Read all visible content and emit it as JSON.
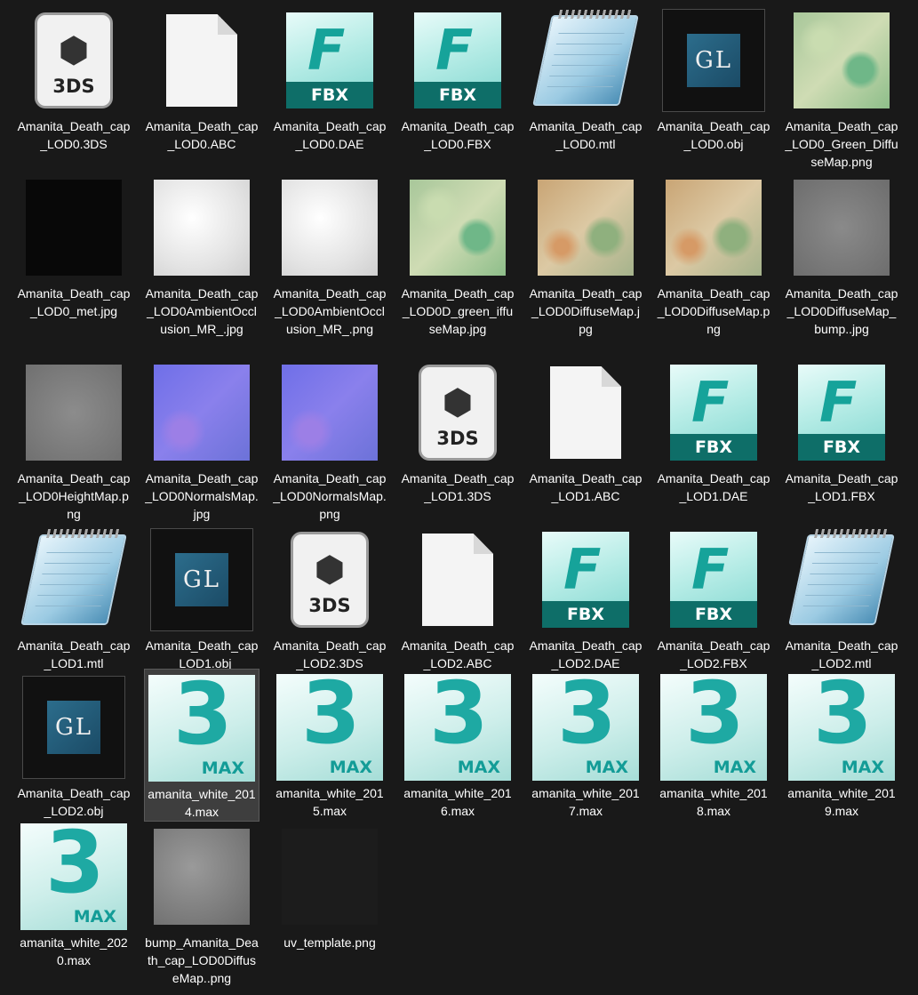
{
  "files": [
    {
      "name": "Amanita_Death_cap_LOD0.3DS",
      "icon": "3ds-icon"
    },
    {
      "name": "Amanita_Death_cap_LOD0.ABC",
      "icon": "blank-file-icon"
    },
    {
      "name": "Amanita_Death_cap_LOD0.DAE",
      "icon": "fbx-icon",
      "icon_text": "FBX"
    },
    {
      "name": "Amanita_Death_cap_LOD0.FBX",
      "icon": "fbx-icon",
      "icon_text": "FBX"
    },
    {
      "name": "Amanita_Death_cap_LOD0.mtl",
      "icon": "notepad-icon"
    },
    {
      "name": "Amanita_Death_cap_LOD0.obj",
      "icon": "opengl-icon",
      "icon_text": "GL"
    },
    {
      "name": "Amanita_Death_cap_LOD0_Green_DiffuseMap.png",
      "icon": "texture-thumbnail",
      "texture": "diffuse"
    },
    {
      "name": "Amanita_Death_cap_LOD0_met.jpg",
      "icon": "texture-thumbnail",
      "texture": "dark"
    },
    {
      "name": "Amanita_Death_cap_LOD0AmbientOcclusion_MR_.jpg",
      "icon": "texture-thumbnail",
      "texture": "ao"
    },
    {
      "name": "Amanita_Death_cap_LOD0AmbientOcclusion_MR_.png",
      "icon": "texture-thumbnail",
      "texture": "ao"
    },
    {
      "name": "Amanita_Death_cap_LOD0D_green_iffuseMap.jpg",
      "icon": "texture-thumbnail",
      "texture": "diffuse"
    },
    {
      "name": "Amanita_Death_cap_LOD0DiffuseMap.jpg",
      "icon": "texture-thumbnail",
      "texture": "diffuse2"
    },
    {
      "name": "Amanita_Death_cap_LOD0DiffuseMap.png",
      "icon": "texture-thumbnail",
      "texture": "diffuse2"
    },
    {
      "name": "Amanita_Death_cap_LOD0DiffuseMap_bump..jpg",
      "icon": "texture-thumbnail",
      "texture": "bump"
    },
    {
      "name": "Amanita_Death_cap_LOD0HeightMap.png",
      "icon": "texture-thumbnail",
      "texture": "height"
    },
    {
      "name": "Amanita_Death_cap_LOD0NormalsMap.jpg",
      "icon": "texture-thumbnail",
      "texture": "normal"
    },
    {
      "name": "Amanita_Death_cap_LOD0NormalsMap.png",
      "icon": "texture-thumbnail",
      "texture": "normal"
    },
    {
      "name": "Amanita_Death_cap_LOD1.3DS",
      "icon": "3ds-icon"
    },
    {
      "name": "Amanita_Death_cap_LOD1.ABC",
      "icon": "blank-file-icon"
    },
    {
      "name": "Amanita_Death_cap_LOD1.DAE",
      "icon": "fbx-icon",
      "icon_text": "FBX"
    },
    {
      "name": "Amanita_Death_cap_LOD1.FBX",
      "icon": "fbx-icon",
      "icon_text": "FBX"
    },
    {
      "name": "Amanita_Death_cap_LOD1.mtl",
      "icon": "notepad-icon"
    },
    {
      "name": "Amanita_Death_cap_LOD1.obj",
      "icon": "opengl-icon",
      "icon_text": "GL"
    },
    {
      "name": "Amanita_Death_cap_LOD2.3DS",
      "icon": "3ds-icon"
    },
    {
      "name": "Amanita_Death_cap_LOD2.ABC",
      "icon": "blank-file-icon"
    },
    {
      "name": "Amanita_Death_cap_LOD2.DAE",
      "icon": "fbx-icon",
      "icon_text": "FBX"
    },
    {
      "name": "Amanita_Death_cap_LOD2.FBX",
      "icon": "fbx-icon",
      "icon_text": "FBX"
    },
    {
      "name": "Amanita_Death_cap_LOD2.mtl",
      "icon": "notepad-icon"
    },
    {
      "name": "Amanita_Death_cap_LOD2.obj",
      "icon": "opengl-icon",
      "icon_text": "GL"
    },
    {
      "name": "amanita_white_2014.max",
      "icon": "3dsmax-icon",
      "icon_text": "MAX",
      "selected": true
    },
    {
      "name": "amanita_white_2015.max",
      "icon": "3dsmax-icon",
      "icon_text": "MAX"
    },
    {
      "name": "amanita_white_2016.max",
      "icon": "3dsmax-icon",
      "icon_text": "MAX"
    },
    {
      "name": "amanita_white_2017.max",
      "icon": "3dsmax-icon",
      "icon_text": "MAX"
    },
    {
      "name": "amanita_white_2018.max",
      "icon": "3dsmax-icon",
      "icon_text": "MAX"
    },
    {
      "name": "amanita_white_2019.max",
      "icon": "3dsmax-icon",
      "icon_text": "MAX"
    },
    {
      "name": "amanita_white_2020.max",
      "icon": "3dsmax-icon",
      "icon_text": "MAX"
    },
    {
      "name": "bump_Amanita_Death_cap_LOD0DiffuseMap..png",
      "icon": "texture-thumbnail",
      "texture": "bump2"
    },
    {
      "name": "uv_template.png",
      "icon": "texture-thumbnail",
      "texture": "uv"
    }
  ],
  "icon_texts": {
    "tds": "3DS"
  },
  "colors": {
    "background": "#191919",
    "selected_bg": "#3e3e3e",
    "fbx_teal": "#0e6e68",
    "max_teal": "#1ea9a3"
  }
}
